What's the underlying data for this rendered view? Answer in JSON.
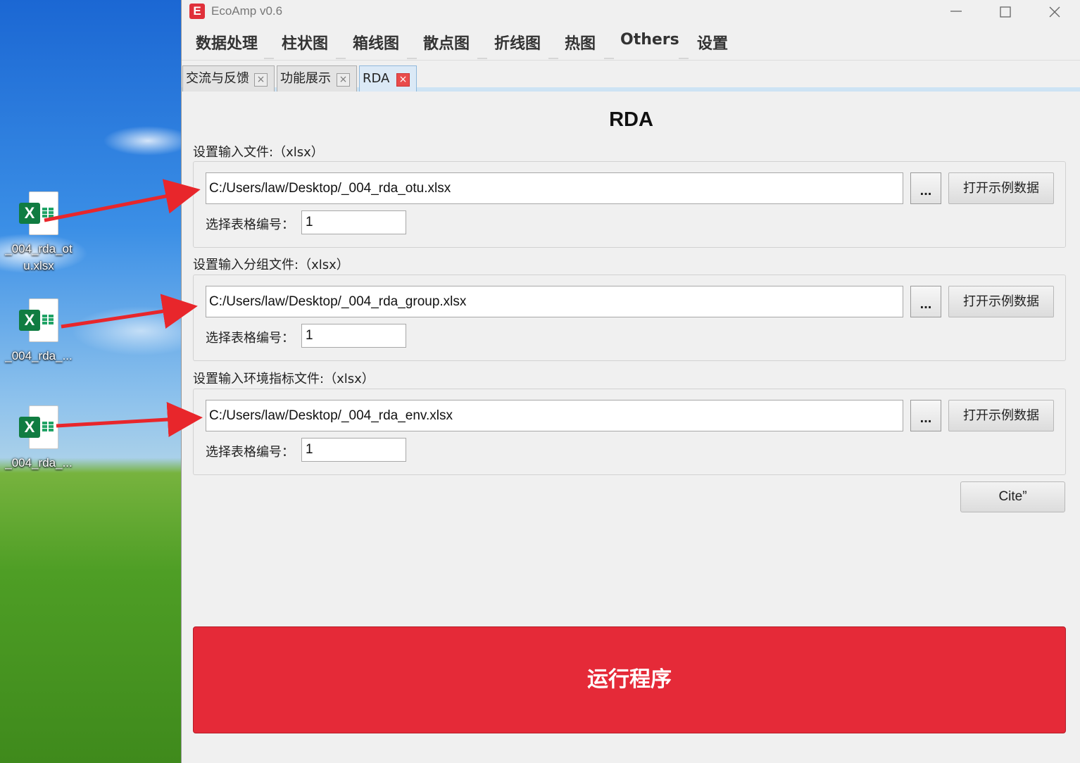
{
  "desktop": {
    "icons": [
      {
        "label": "_004_rda_ot u.xlsx",
        "type": "excel-file"
      },
      {
        "label": "_004_rda_...",
        "type": "excel-file"
      },
      {
        "label": "_004_rda_...",
        "type": "excel-file"
      }
    ]
  },
  "window": {
    "logo": "E",
    "title": "EcoAmp v0.6",
    "controls": {
      "minimize": "minimize-icon",
      "maximize": "maximize-icon",
      "close": "close-icon"
    }
  },
  "menu": [
    "数据处理",
    "柱状图",
    "箱线图",
    "散点图",
    "折线图",
    "热图",
    "Others",
    "设置"
  ],
  "tabs": [
    {
      "label": "交流与反馈",
      "active": false
    },
    {
      "label": "功能展示",
      "active": false
    },
    {
      "label": "RDA",
      "active": true
    }
  ],
  "page": {
    "title": "RDA",
    "sections": [
      {
        "label": "设置输入文件:（xlsx）",
        "path": "C:/Users/law/Desktop/_004_rda_otu.xlsx",
        "browse": "...",
        "example": "打开示例数据",
        "sheet_label": "选择表格编号：",
        "sheet_value": "1"
      },
      {
        "label": "设置输入分组文件:（xlsx）",
        "path": "C:/Users/law/Desktop/_004_rda_group.xlsx",
        "browse": "...",
        "example": "打开示例数据",
        "sheet_label": "选择表格编号：",
        "sheet_value": "1"
      },
      {
        "label": "设置输入环境指标文件:（xlsx）",
        "path": "C:/Users/law/Desktop/_004_rda_env.xlsx",
        "browse": "...",
        "example": "打开示例数据",
        "sheet_label": "选择表格编号：",
        "sheet_value": "1"
      }
    ],
    "cite": "Cite”",
    "run": "运行程序"
  },
  "colors": {
    "run_button": "#e52a38",
    "annotation_arrow": "#e8262b",
    "excel_green": "#107c41",
    "app_logo": "#e0303a"
  }
}
